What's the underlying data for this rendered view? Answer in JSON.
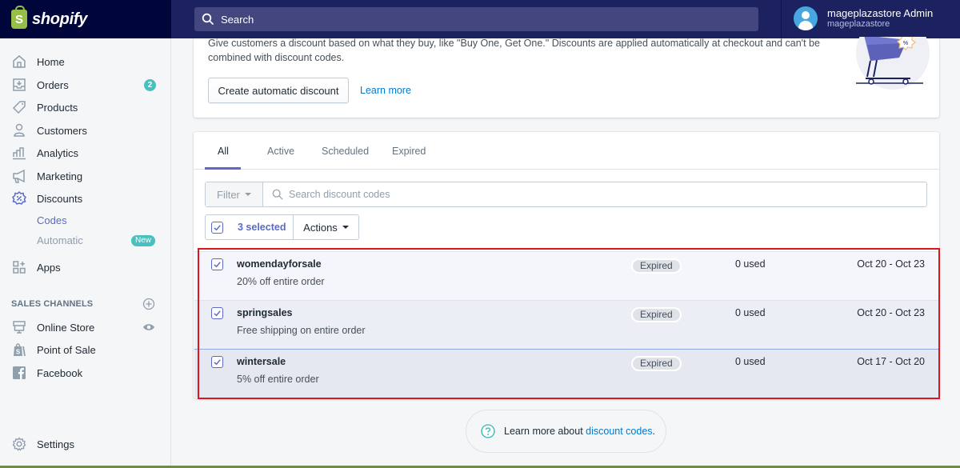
{
  "brand": {
    "name": "shopify",
    "logo_letter": "S"
  },
  "topbar": {
    "search_placeholder": "Search",
    "account_name": "mageplazastore Admin",
    "account_store": "mageplazastore"
  },
  "sidebar": {
    "items": [
      {
        "label": "Home",
        "icon": "home-icon"
      },
      {
        "label": "Orders",
        "icon": "orders-icon",
        "badge": "2"
      },
      {
        "label": "Products",
        "icon": "tag-icon"
      },
      {
        "label": "Customers",
        "icon": "person-icon"
      },
      {
        "label": "Analytics",
        "icon": "bar-chart-icon"
      },
      {
        "label": "Marketing",
        "icon": "megaphone-icon"
      },
      {
        "label": "Discounts",
        "icon": "discount-icon"
      }
    ],
    "discount_sub": [
      {
        "label": "Codes",
        "active": true
      },
      {
        "label": "Automatic",
        "badge": "New"
      }
    ],
    "apps_label": "Apps",
    "sales_channels_title": "SALES CHANNELS",
    "channels": [
      {
        "label": "Online Store",
        "icon": "store-icon"
      },
      {
        "label": "Point of Sale",
        "icon": "pos-bag-icon"
      },
      {
        "label": "Facebook",
        "icon": "facebook-icon"
      }
    ],
    "settings_label": "Settings"
  },
  "automatic_card": {
    "description": "Give customers a discount based on what they buy, like \"Buy One, Get One.\" Discounts are applied automatically at checkout and can't be combined with discount codes.",
    "create_button": "Create automatic discount",
    "learn_more": "Learn more"
  },
  "codes_card": {
    "tabs": [
      "All",
      "Active",
      "Scheduled",
      "Expired"
    ],
    "active_tab": "All",
    "filter_label": "Filter",
    "search_placeholder": "Search discount codes",
    "selected_label": "3 selected",
    "actions_label": "Actions",
    "rows": [
      {
        "code": "womendayforsale",
        "summary": "20% off entire order",
        "status": "Expired",
        "usage": "0 used",
        "dates": "Oct 20 - Oct 23",
        "checked": true
      },
      {
        "code": "springsales",
        "summary": "Free shipping on entire order",
        "status": "Expired",
        "usage": "0 used",
        "dates": "Oct 20 - Oct 23",
        "checked": true
      },
      {
        "code": "wintersale",
        "summary": "5% off entire order",
        "status": "Expired",
        "usage": "0 used",
        "dates": "Oct 17 - Oct 20",
        "checked": true
      }
    ]
  },
  "footer": {
    "help_text": "Learn more about ",
    "help_link": "discount codes",
    "help_suffix": "."
  },
  "colors": {
    "topbar": "#1c2260",
    "logo_area": "#000639",
    "accent": "#5c6ac4",
    "teal_badge": "#47c1bf",
    "link": "#007ace",
    "highlight_border": "#e0141e"
  }
}
